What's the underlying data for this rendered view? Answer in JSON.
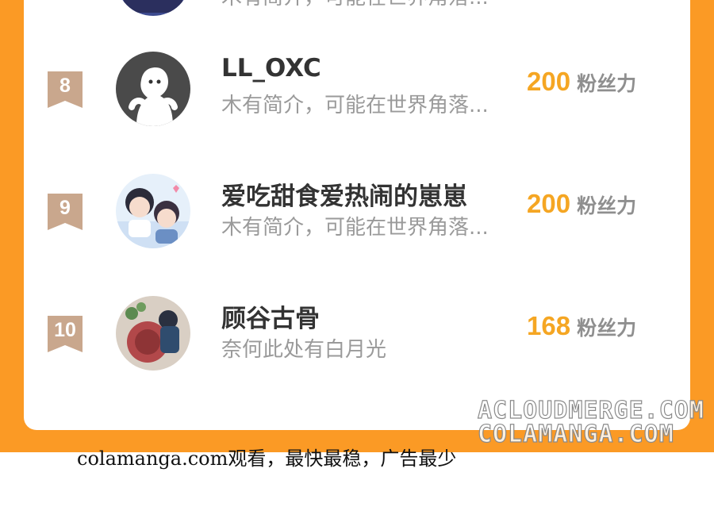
{
  "ranking": [
    {
      "rank": "",
      "name": "",
      "bio": "木有简介，可能在世界角落...",
      "fans_count": "",
      "fans_label": ""
    },
    {
      "rank": "8",
      "name": "LL_OXC",
      "bio": "木有简介，可能在世界角落...",
      "fans_count": "200",
      "fans_label": "粉丝力"
    },
    {
      "rank": "9",
      "name": "爱吃甜食爱热闹的崽崽",
      "bio": "木有简介，可能在世界角落...",
      "fans_count": "200",
      "fans_label": "粉丝力"
    },
    {
      "rank": "10",
      "name": "顾谷古骨",
      "bio": "奈何此处有白月光",
      "fans_count": "168",
      "fans_label": "粉丝力"
    }
  ],
  "watermark": {
    "line1": "ACLOUDMERGE.COM",
    "line2": "COLAMANGA.COM"
  },
  "footer_note": "colamanga.com观看，最快最稳，广告最少",
  "colors": {
    "frame_orange": "#fb9a25",
    "fans_count": "#f5a623",
    "rank_badge": "#c9a78d"
  },
  "icons": {
    "rank_badge": "ribbon-badge-icon",
    "default_avatar": "ghost-avatar-icon"
  }
}
